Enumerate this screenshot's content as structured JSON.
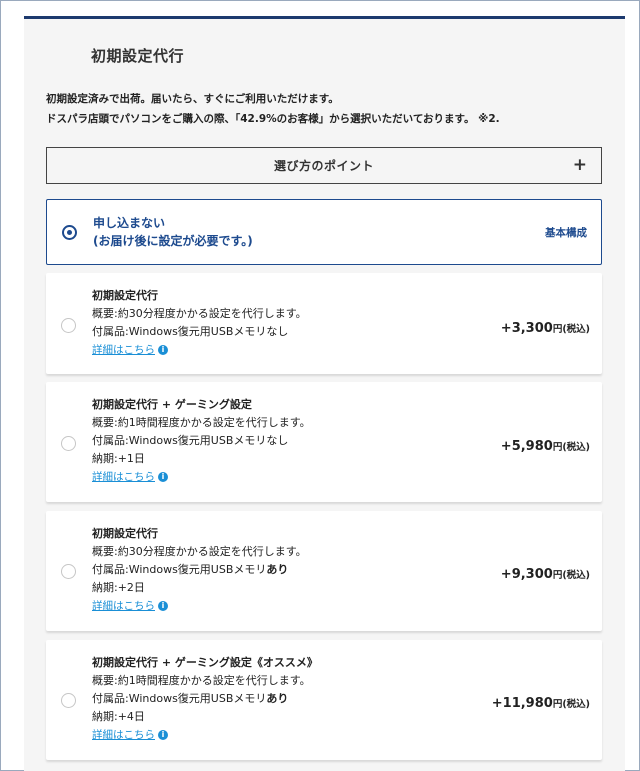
{
  "section": {
    "title": "初期設定代行",
    "intro_line1": "初期設定済みで出荷。届いたら、すぐにご利用いただけます。",
    "intro_line2": "ドスパラ店頭でパソコンをご購入の際、「42.9%のお客様」から選択いただいております。 ※2."
  },
  "accordion": {
    "label": "選び方のポイント",
    "toggle": "+"
  },
  "selected_option": {
    "line1": "申し込まない",
    "line2": "(お届け後に設定が必要です。)",
    "badge": "基本構成"
  },
  "options": [
    {
      "title": "初期設定代行",
      "summary": "概要:約30分程度かかる設定を代行します。",
      "accessory_prefix": "付属品:Windows復元用USBメモリ",
      "accessory_value": "なし",
      "delivery": "",
      "link": "詳細はこちら",
      "price": "+3,300",
      "unit": "円(税込)"
    },
    {
      "title": "初期設定代行 + ゲーミング設定",
      "summary": "概要:約1時間程度かかる設定を代行します。",
      "accessory_prefix": "付属品:Windows復元用USBメモリ",
      "accessory_value": "なし",
      "delivery": "納期:+1日",
      "link": "詳細はこちら",
      "price": "+5,980",
      "unit": "円(税込)"
    },
    {
      "title": "初期設定代行",
      "summary": "概要:約30分程度かかる設定を代行します。",
      "accessory_prefix": "付属品:Windows復元用USBメモリ",
      "accessory_value": "あり",
      "delivery": "納期:+2日",
      "link": "詳細はこちら",
      "price": "+9,300",
      "unit": "円(税込)"
    },
    {
      "title": "初期設定代行 + ゲーミング設定《オススメ》",
      "summary": "概要:約1時間程度かかる設定を代行します。",
      "accessory_prefix": "付属品:Windows復元用USBメモリ",
      "accessory_value": "あり",
      "delivery": "納期:+4日",
      "link": "詳細はこちら",
      "price": "+11,980",
      "unit": "円(税込)"
    }
  ],
  "colors": {
    "accent": "#1d4a8e",
    "link": "#1a8fd6",
    "top_border": "#1d3a6e",
    "panel_bg": "#f5f5f5"
  }
}
